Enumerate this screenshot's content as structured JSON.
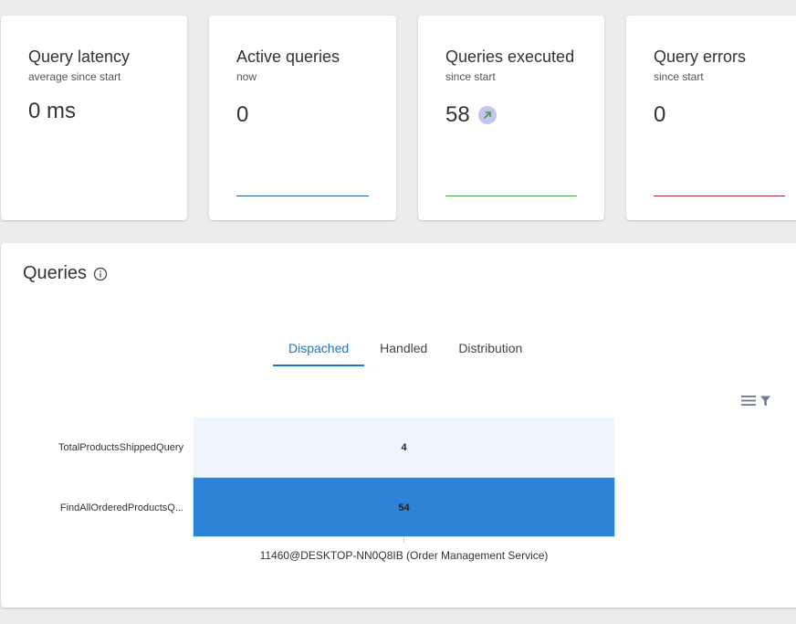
{
  "cards": [
    {
      "title": "Query latency",
      "subtitle": "average since start",
      "value": "0 ms",
      "spark_color": ""
    },
    {
      "title": "Active queries",
      "subtitle": "now",
      "value": "0",
      "spark_color": "#1f5f99"
    },
    {
      "title": "Queries executed",
      "subtitle": "since start",
      "value": "58",
      "spark_color": "#3ea348"
    },
    {
      "title": "Query errors",
      "subtitle": "since start",
      "value": "0",
      "spark_color": "#9b2a3a"
    }
  ],
  "queries_panel": {
    "title": "Queries",
    "tabs": [
      {
        "label": "Dispached",
        "active": true
      },
      {
        "label": "Handled",
        "active": false
      },
      {
        "label": "Distribution",
        "active": false
      }
    ]
  },
  "chart_data": {
    "type": "heatmap",
    "y_categories": [
      "TotalProductsShippedQuery",
      "FindAllOrderedProductsQ..."
    ],
    "x_categories": [
      "11460@DESKTOP-NN0Q8IB (Order Management Service)"
    ],
    "values": [
      [
        4
      ],
      [
        54
      ]
    ],
    "colors": {
      "low": "#eef5fc",
      "high": "#2d83d7"
    }
  }
}
